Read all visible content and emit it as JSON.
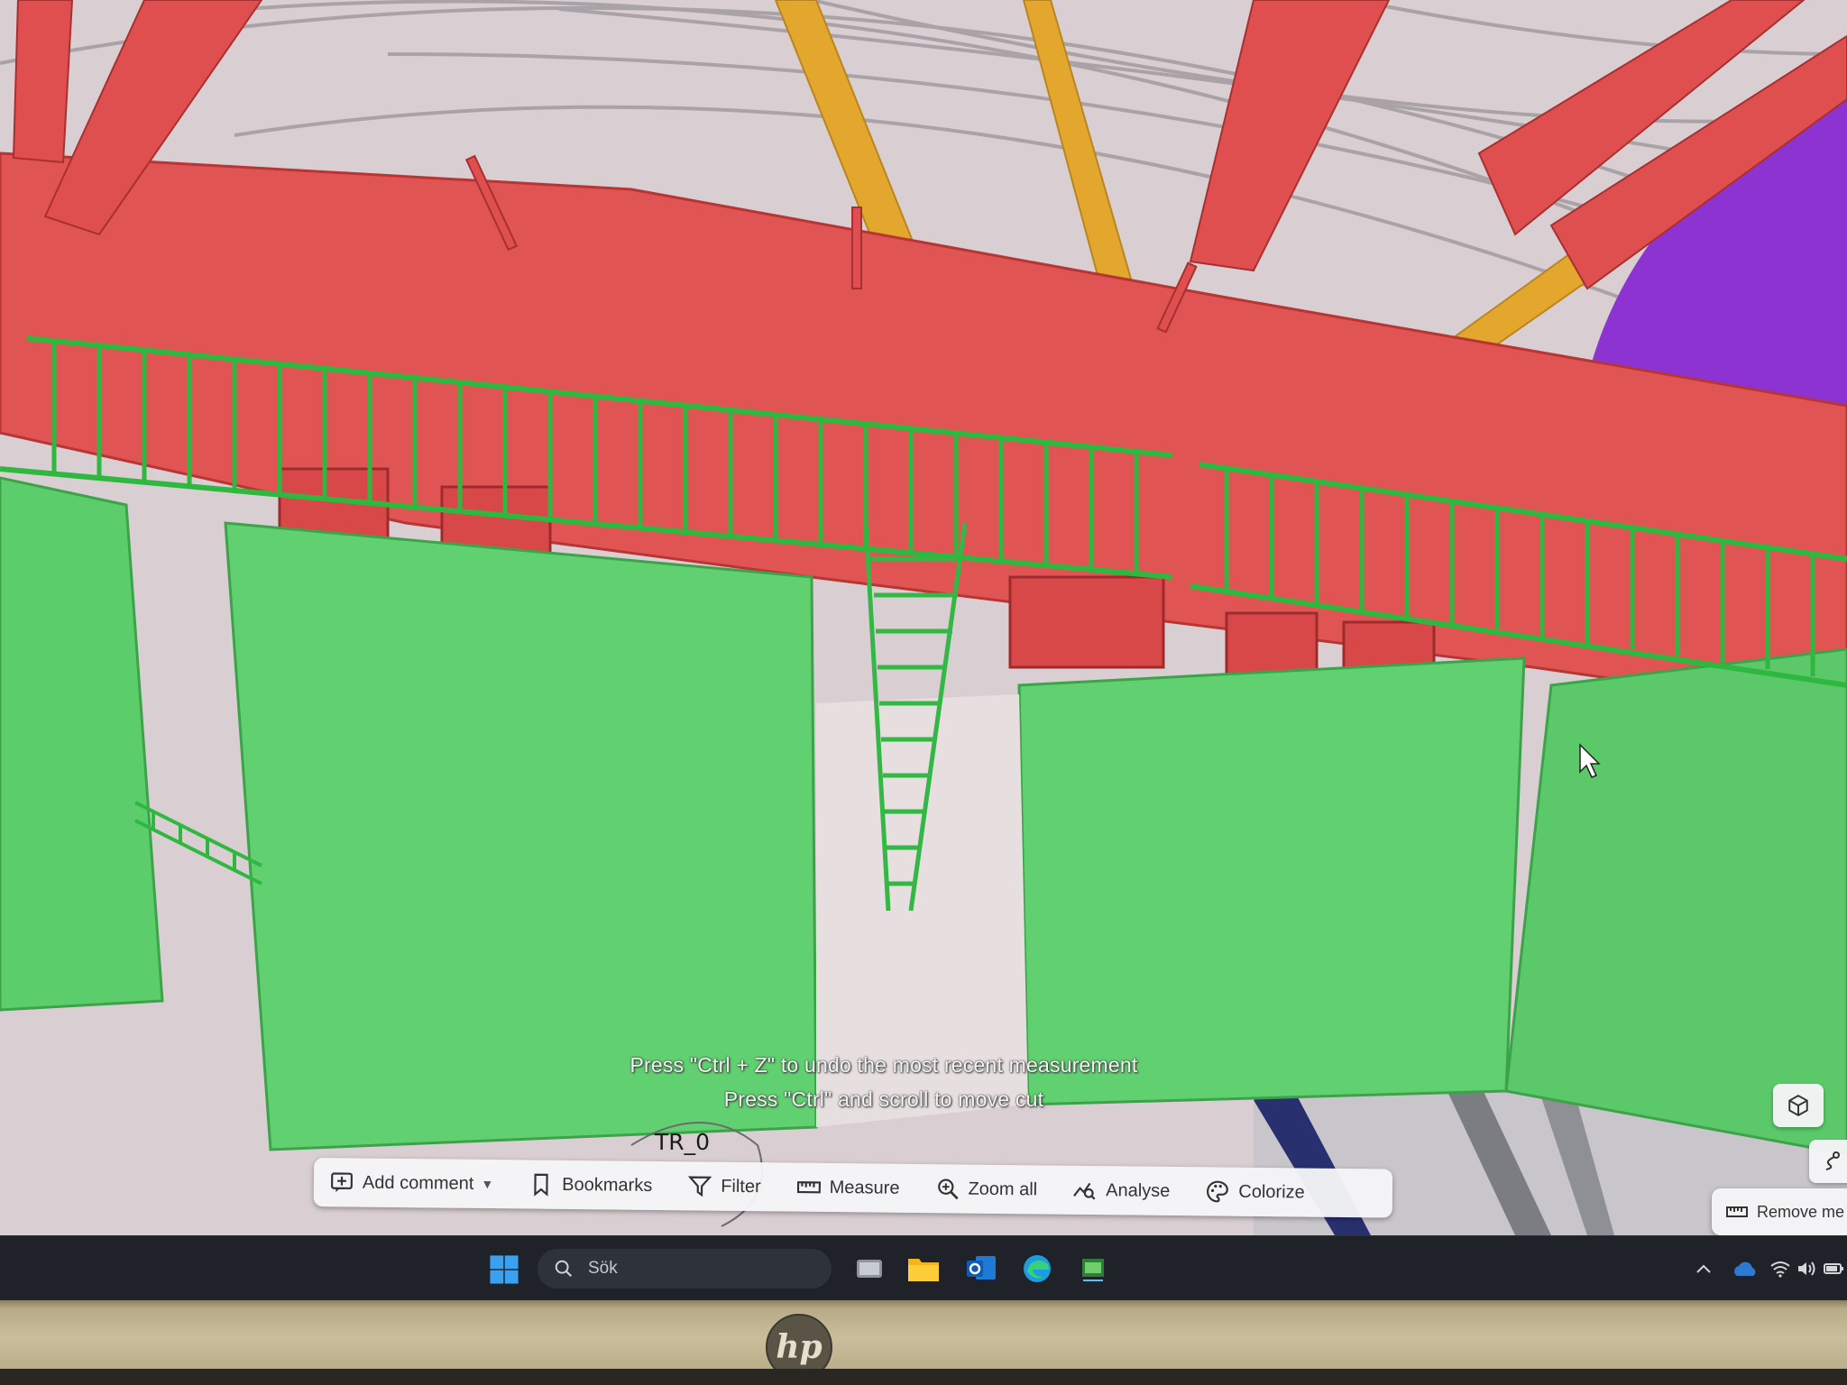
{
  "viewer": {
    "hints": {
      "undo": "Press \"Ctrl + Z\" to undo the most recent measurement",
      "scroll": "Press \"Ctrl\" and scroll to move cut"
    },
    "grid_label": "TR_0",
    "toolbar": {
      "add_comment": "Add comment",
      "bookmarks": "Bookmarks",
      "filter": "Filter",
      "measure": "Measure",
      "zoom_all": "Zoom all",
      "analyse": "Analyse",
      "colorize": "Colorize"
    },
    "remove_measurement": "Remove me"
  },
  "model_colors": {
    "steel_beam": "#e05252",
    "panel_green": "#5fce6e",
    "railing_green": "#2fb83f",
    "roof_brace": "#e0a62a",
    "duct_purple": "#8a2fd0",
    "interior": "#d8cdd0"
  },
  "taskbar": {
    "search_placeholder": "Sök",
    "icons": [
      "windows-start-icon",
      "search-icon",
      "task-view-icon",
      "file-explorer-icon",
      "outlook-icon",
      "edge-icon",
      "app-icon"
    ],
    "tray": [
      "chevron-up-icon",
      "onedrive-icon",
      "wifi-icon",
      "volume-icon",
      "battery-icon"
    ]
  },
  "monitor": {
    "brand": "hp"
  }
}
